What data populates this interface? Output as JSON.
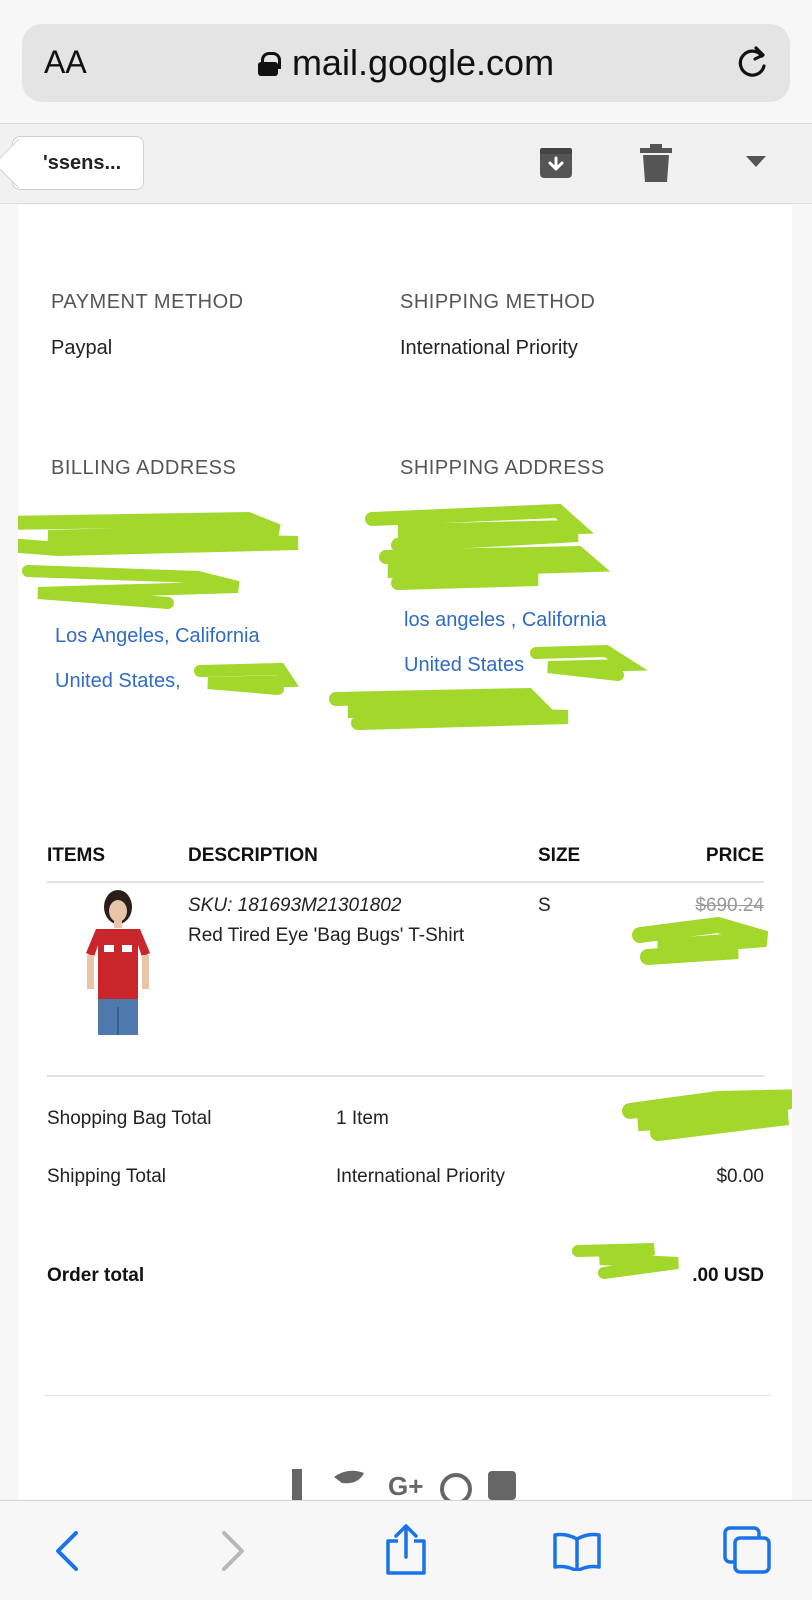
{
  "browser": {
    "text_size_label": "AA",
    "url": "mail.google.com",
    "icons": [
      "lock-icon",
      "reload-icon"
    ]
  },
  "gmail_toolbar": {
    "back_label": "'ssens...",
    "icons": [
      "archive-icon",
      "trash-icon",
      "more-dropdown-icon"
    ]
  },
  "order": {
    "payment": {
      "label": "PAYMENT METHOD",
      "value": "Paypal"
    },
    "shipping_method": {
      "label": "SHIPPING METHOD",
      "value": "International Priority"
    },
    "billing": {
      "label": "BILLING ADDRESS",
      "city_line": "Los Angeles, California",
      "country_line": "United States,"
    },
    "shipping": {
      "label": "SHIPPING ADDRESS",
      "city_line": "los angeles , California",
      "country_line": "United States"
    },
    "table_headers": {
      "items": "ITEMS",
      "description": "DESCRIPTION",
      "size": "SIZE",
      "price": "PRICE"
    },
    "item": {
      "sku": "SKU: 181693M21301802",
      "name": "Red Tired Eye 'Bag Bugs' T-Shirt",
      "size": "S",
      "original_price": "$690.24"
    },
    "summary": {
      "bag_total_label": "Shopping Bag Total",
      "bag_total_count": "1 Item",
      "shipping_total_label": "Shipping Total",
      "shipping_total_method": "International Priority",
      "shipping_total_value": "$0.00",
      "order_total_label": "Order total",
      "order_total_value_visible": ".00 USD"
    },
    "redaction_color": "#a2d72c"
  },
  "bottom_bar": {
    "icons": [
      "back-arrow-icon",
      "forward-arrow-icon",
      "share-icon",
      "bookmarks-icon",
      "tabs-icon"
    ],
    "accent": "#1a73e8"
  }
}
